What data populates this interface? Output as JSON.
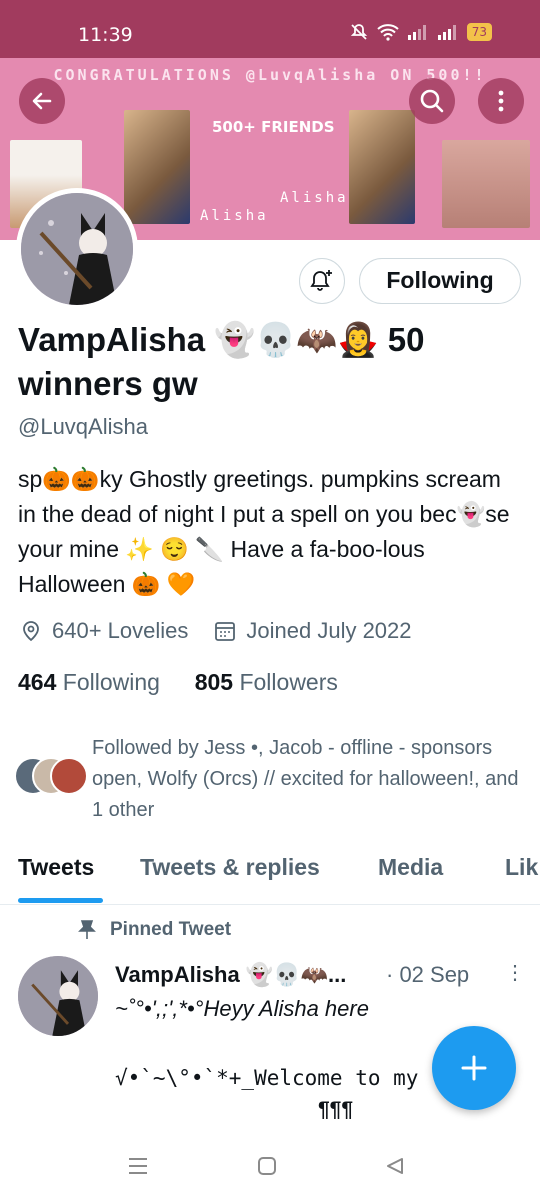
{
  "status_bar": {
    "time": "11:39",
    "battery": "73"
  },
  "banner": {
    "headline": "CONGRATULATIONS @LuvqAlisha ON 500!!",
    "friends_text": "500+ FRIENDS",
    "name_text_1": "Alisha",
    "name_text_2": "Alisha",
    "bg_color": "#e48ab0"
  },
  "profile": {
    "display_name": "VampAlisha 👻💀🦇🧛‍♀️ 50 winners gw",
    "handle": "@LuvqAlisha",
    "bio": "sp🎃🎃ky   Ghostly greetings. pumpkins scream in the dead of night I put a spell on you bec👻se your mine ✨ 😌 🔪  Have a fa-boo-lous Halloween 🎃 🧡",
    "location": "640+ Lovelies",
    "joined": "Joined July 2022",
    "following_count": "464",
    "following_label": "Following",
    "followers_count": "805",
    "followers_label": "Followers",
    "followed_by": "Followed by Jess •, Jacob - offline - sponsors open, Wolfy (Orcs) // excited for halloween!, and 1 other",
    "follow_button": "Following"
  },
  "tabs": [
    {
      "label": "Tweets",
      "active": true
    },
    {
      "label": "Tweets & replies",
      "active": false
    },
    {
      "label": "Media",
      "active": false
    },
    {
      "label": "Lik",
      "active": false
    }
  ],
  "pinned_tweet": {
    "pinned_label": "Pinned Tweet",
    "author": "VampAlisha 👻💀🦇...",
    "date": "· 02 Sep",
    "line1": "~˚°•',;',*•°Heyy Alisha here",
    "line2": "√•`~\\°•`*+_Welcome to my",
    "line3": "¶¶¶"
  },
  "colors": {
    "accent": "#1d9bf0",
    "status_bar": "#a13b5e"
  },
  "icons": [
    "back-arrow-icon",
    "search-icon",
    "more-vertical-icon",
    "bell-plus-icon",
    "location-pin-icon",
    "calendar-icon",
    "pin-icon",
    "plus-icon",
    "wifi-icon",
    "mute-icon",
    "signal-icon"
  ]
}
